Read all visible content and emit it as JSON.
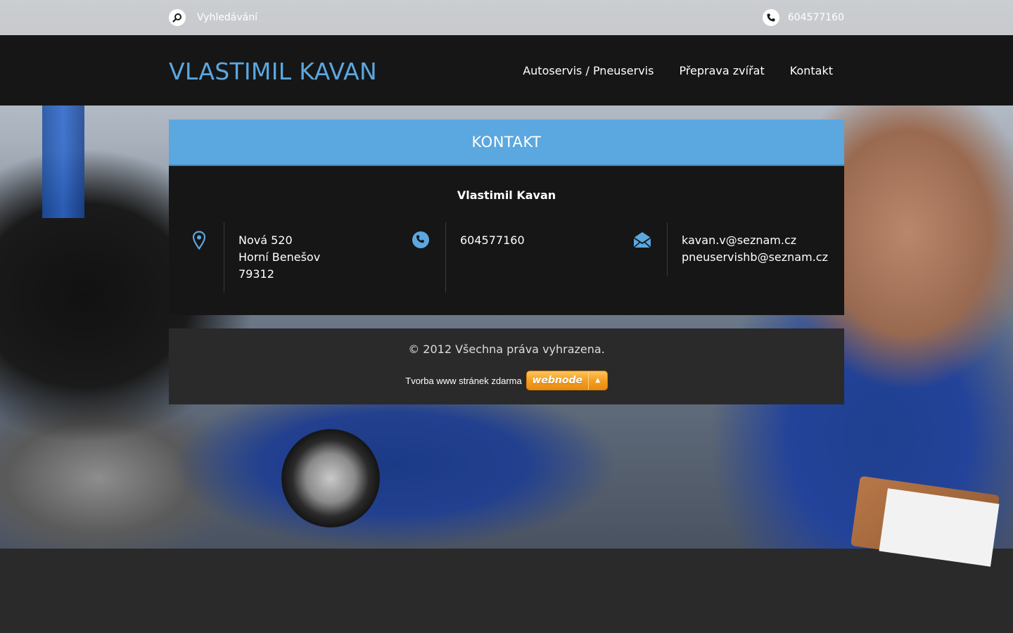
{
  "topbar": {
    "search_placeholder": "Vyhledávání",
    "phone": "604577160"
  },
  "header": {
    "logo": "VLASTIMIL KAVAN",
    "nav": [
      {
        "label": "Autoservis / Pneuservis"
      },
      {
        "label": "Přeprava zvířat"
      },
      {
        "label": "Kontakt"
      }
    ]
  },
  "contact": {
    "title": "KONTAKT",
    "name": "Vlastimil Kavan",
    "address": {
      "street": "Nová 520",
      "city": "Horní Benešov",
      "zip": "79312"
    },
    "phone": "604577160",
    "emails": [
      "kavan.v@seznam.cz",
      "pneuservishb@seznam.cz"
    ]
  },
  "footer": {
    "copyright": "© 2012 Všechna práva vyhrazena.",
    "credit_text": "Tvorba www stránek zdarma",
    "badge_label": "webnode",
    "badge_arrow": "▲"
  },
  "colors": {
    "accent": "#5ba7e0",
    "header_bg": "#161616",
    "footer_bg": "#2a2a2a",
    "badge": "#f39c1e"
  },
  "icons": {
    "search": "search-icon",
    "phone": "phone-icon",
    "location": "map-pin-icon",
    "mail": "envelope-icon"
  }
}
